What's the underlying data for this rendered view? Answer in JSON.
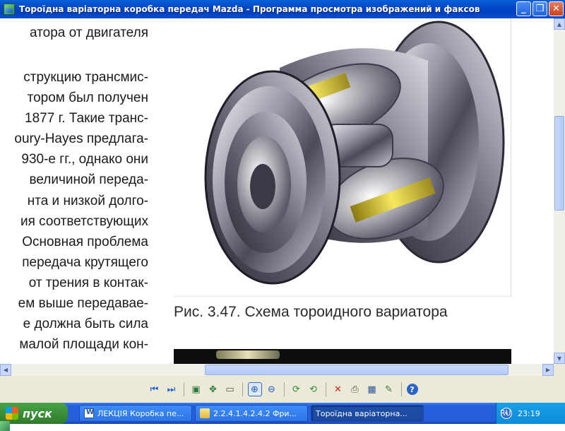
{
  "window": {
    "title": "Тороїдна варіаторна коробка передач  Mazda - Программа просмотра изображений и факсов",
    "minimize": "_",
    "maximize": "❐",
    "close": "✕"
  },
  "document": {
    "text_lines": [
      "атора  от  двигателя",
      "струкцию трансмис-",
      "тором  был  получен",
      "1877 г. Такие транс-",
      "oury-Hayes предлага-",
      "930-е гг., однако они",
      "величиной переда-",
      "нта  и  низкой  долго-",
      "ия  соответствующих",
      "Основная проблема",
      "передача  крутящего",
      "от трения в контак-",
      "ем выше передавае-",
      "е  должна  быть  сила",
      "малой площади кон-"
    ],
    "caption": "Рис. 3.47. Схема тороидного вариатора"
  },
  "scrollbars": {
    "up": "▲",
    "down": "▼",
    "left": "◀",
    "right": "▶"
  },
  "toolbar": {
    "buttons": [
      {
        "name": "prev-image-icon",
        "glyph": "⏮"
      },
      {
        "name": "next-image-icon",
        "glyph": "⏭"
      },
      {
        "name": "best-fit-icon",
        "glyph": "▣"
      },
      {
        "name": "actual-size-icon",
        "glyph": "✥"
      },
      {
        "name": "slideshow-icon",
        "glyph": "▭"
      },
      {
        "name": "zoom-in-icon",
        "glyph": "⊕"
      },
      {
        "name": "zoom-out-icon",
        "glyph": "⊖"
      },
      {
        "name": "rotate-clockwise-icon",
        "glyph": "⟳"
      },
      {
        "name": "rotate-counterclockwise-icon",
        "glyph": "⟲"
      },
      {
        "name": "delete-icon",
        "glyph": "✕"
      },
      {
        "name": "print-icon",
        "glyph": "⎙"
      },
      {
        "name": "save-icon",
        "glyph": "▦"
      },
      {
        "name": "edit-icon",
        "glyph": "✎"
      },
      {
        "name": "help-icon",
        "glyph": "?"
      }
    ]
  },
  "taskbar": {
    "start_label": "пуск",
    "tasks": [
      {
        "label": "ЛЕКЦІЯ Коробка пе...",
        "icon": "word"
      },
      {
        "label": "2.2.4.1.4.2.4.2 Фри...",
        "icon": "folder"
      },
      {
        "label": "Тороїдна варіаторна...",
        "icon": "viewer"
      }
    ],
    "language": "RU",
    "tray_arrow": "«",
    "clock": "23:19"
  },
  "colors": {
    "titlebar": "#0347c8",
    "taskbar": "#245edb",
    "start_button": "#3a8f38",
    "tray": "#0f8ad6"
  }
}
